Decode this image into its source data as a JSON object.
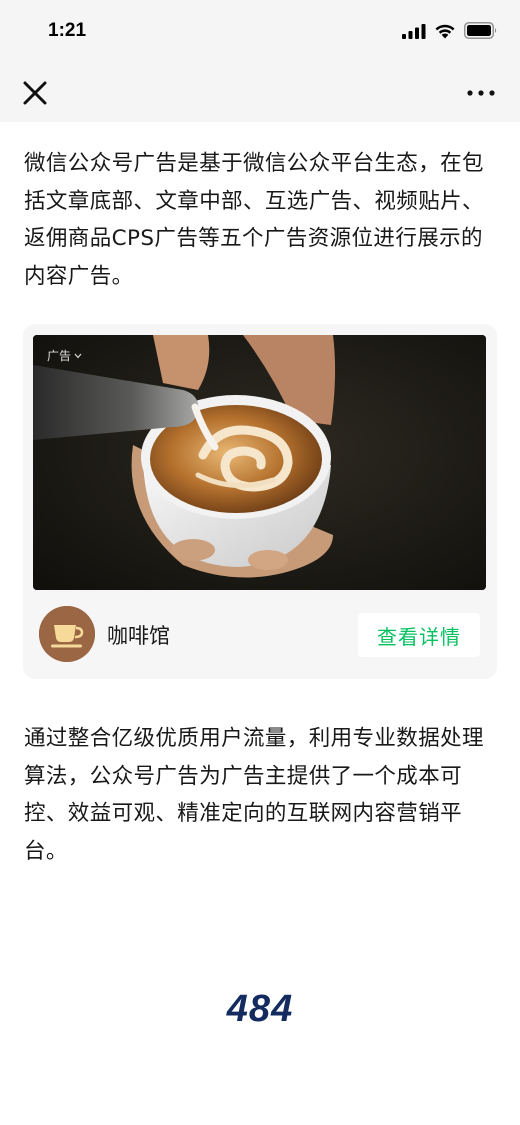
{
  "status_bar": {
    "time": "1:21"
  },
  "nav_bar": {
    "close_icon": "close-icon",
    "more_icon": "more-horizontal-icon"
  },
  "article": {
    "paragraph_1": "微信公众号广告是基于微信公众平台生态，在包括文章底部、文章中部、互选广告、视频贴片、返佣商品CPS广告等五个广告资源位进行展示的内容广告。",
    "paragraph_2": "通过整合亿级优质用户流量，利用专业数据处理算法，公众号广告为广告主提供了一个成本可控、效益可观、精准定向的互联网内容营销平台。"
  },
  "ad_card": {
    "tag_label": "广告",
    "brand_name": "咖啡馆",
    "cta_label": "查看详情",
    "image_subject": "latte-art-pour",
    "cta_color": "#07c160",
    "avatar_color": "#9a6644"
  },
  "page_counter": "484"
}
